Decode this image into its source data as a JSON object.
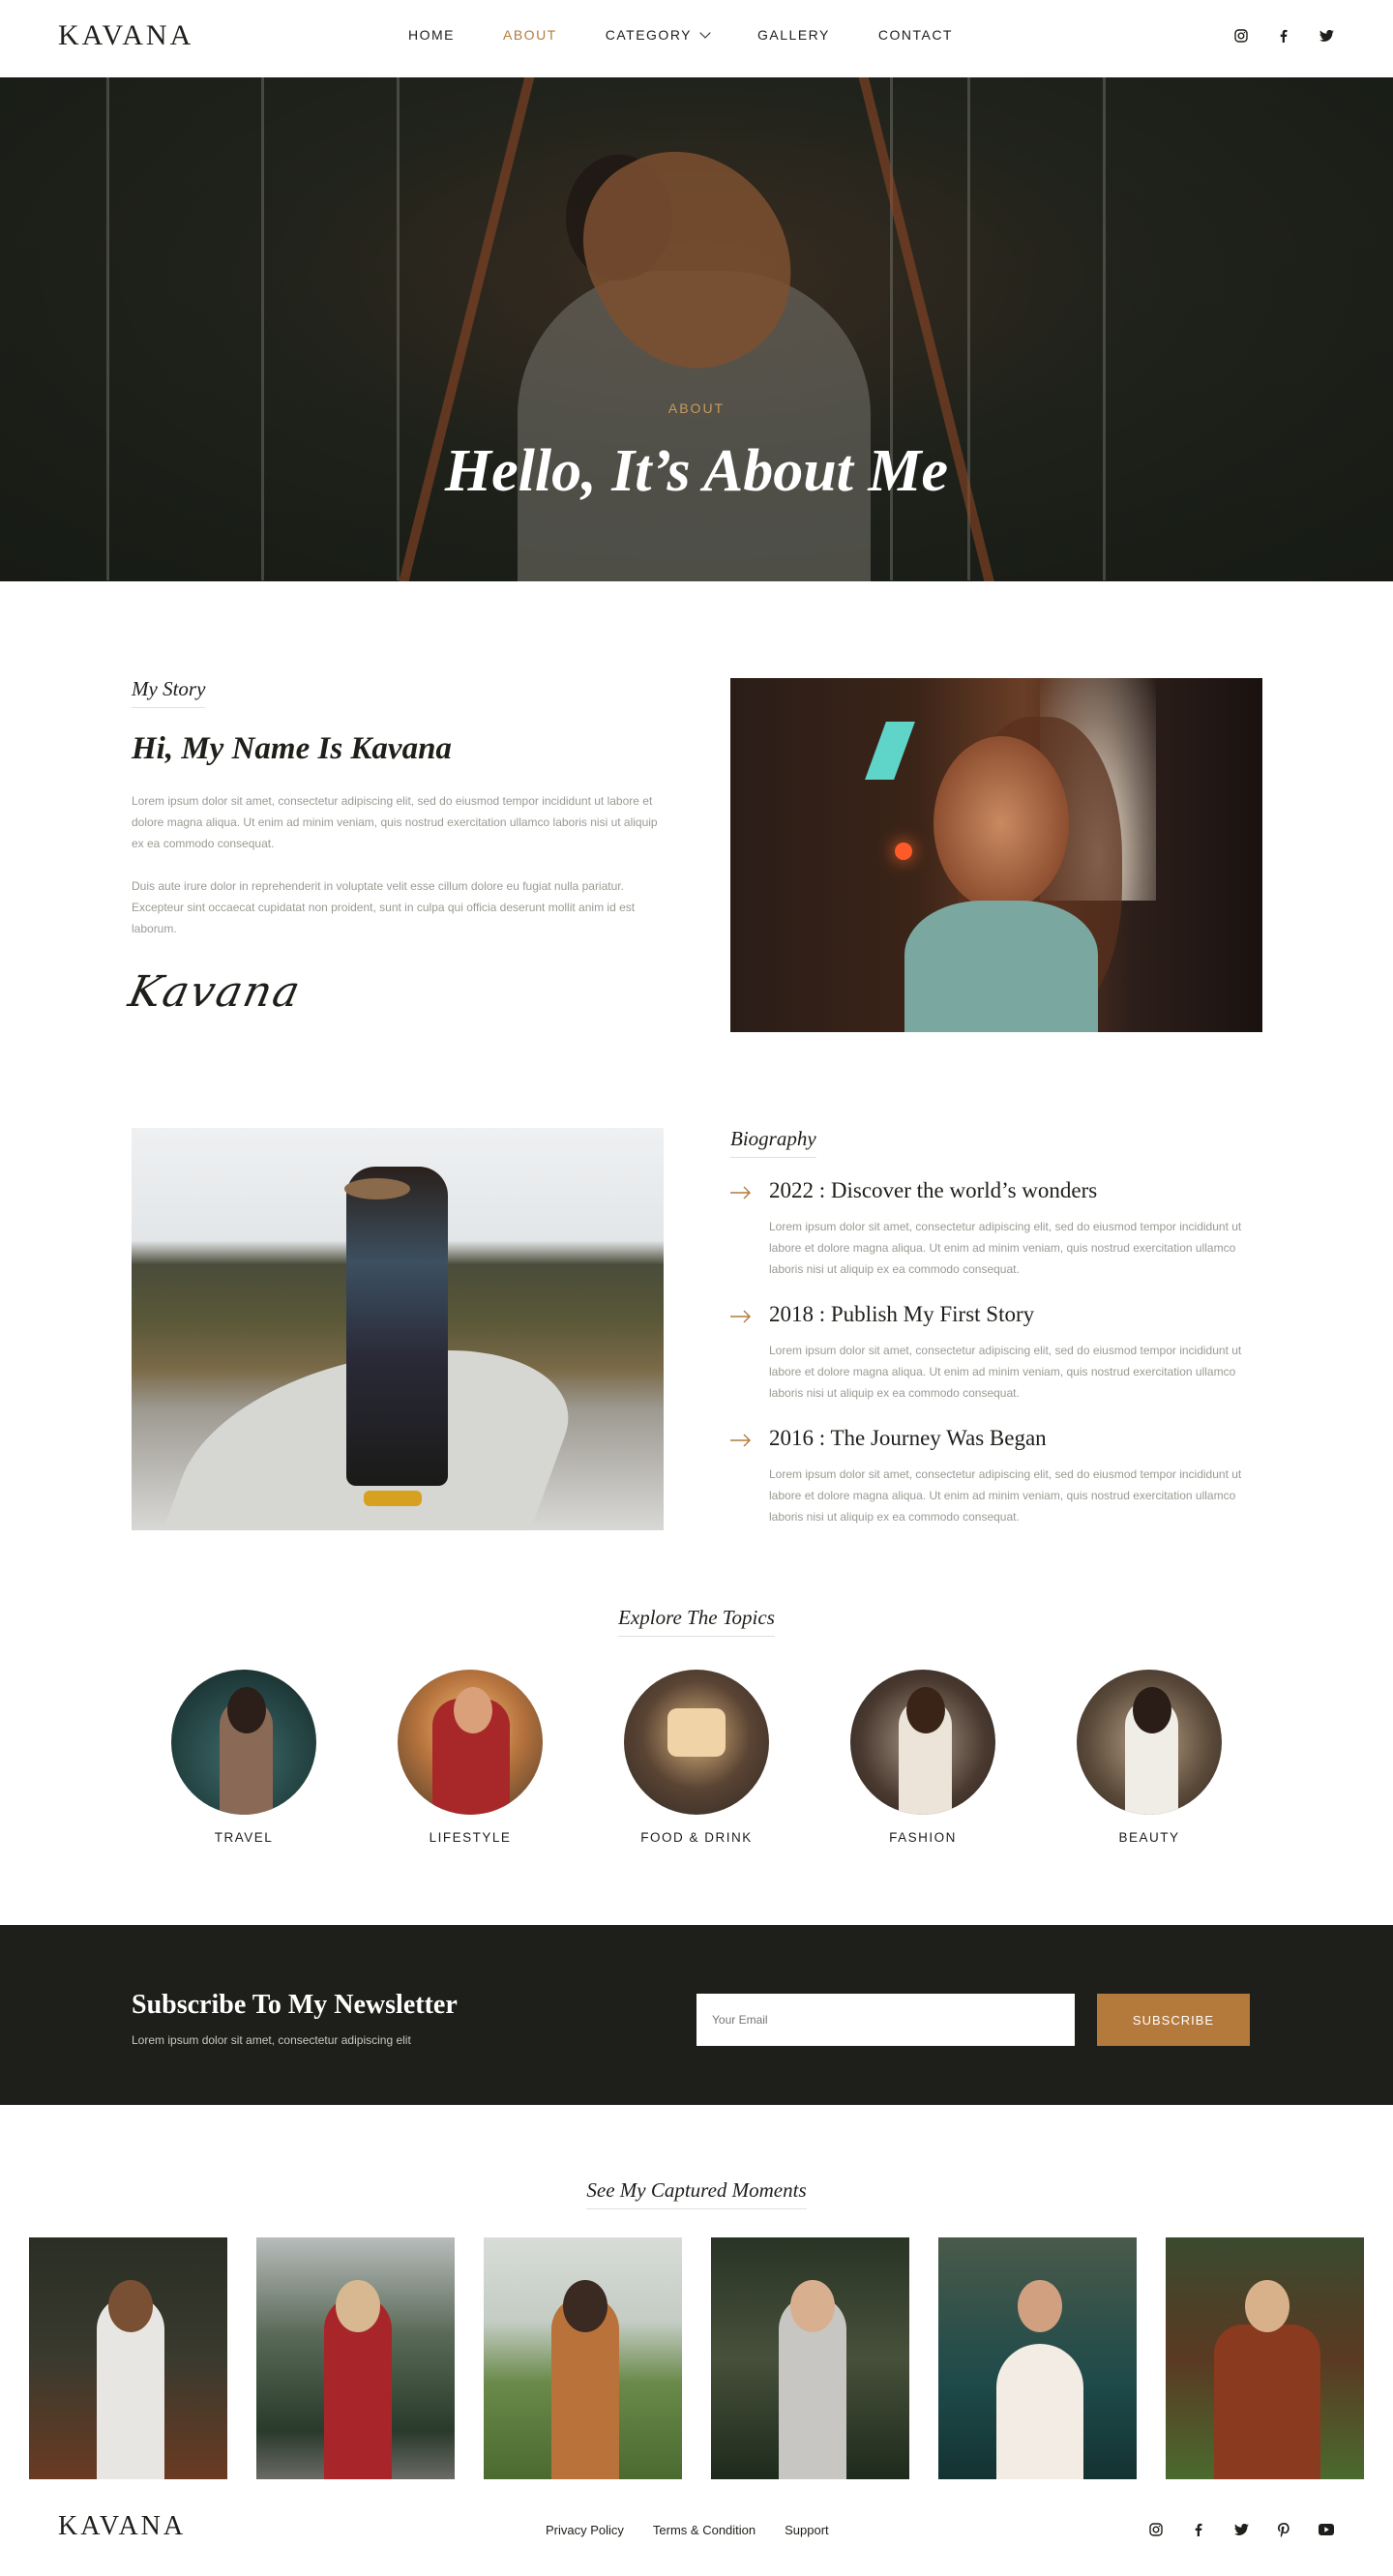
{
  "brand": {
    "logo": "KAVANA"
  },
  "nav": {
    "items": [
      {
        "label": "HOME",
        "active": false
      },
      {
        "label": "ABOUT",
        "active": true
      },
      {
        "label": "CATEGORY",
        "active": false,
        "has_dropdown": true
      },
      {
        "label": "GALLERY",
        "active": false
      },
      {
        "label": "CONTACT",
        "active": false
      }
    ]
  },
  "social_icons": [
    "instagram-icon",
    "facebook-icon",
    "twitter-icon"
  ],
  "hero": {
    "kicker": "ABOUT",
    "title": "Hello, It’s About Me"
  },
  "story": {
    "label": "My Story",
    "title": "Hi, My Name Is Kavana",
    "paragraph_1": "Lorem ipsum dolor sit amet, consectetur adipiscing elit, sed do eiusmod tempor incididunt ut labore et dolore magna aliqua. Ut enim ad minim veniam, quis nostrud exercitation ullamco laboris nisi ut aliquip ex ea commodo consequat.",
    "paragraph_2": "Duis aute irure dolor in reprehenderit in voluptate velit esse cillum dolore eu fugiat nulla pariatur. Excepteur sint occaecat cupidatat non proident, sunt in culpa qui officia deserunt mollit anim id est laborum.",
    "signature": "Kavana"
  },
  "biography": {
    "label": "Biography",
    "items": [
      {
        "title": "2022 : Discover the world’s wonders",
        "text": "Lorem ipsum dolor sit amet, consectetur adipiscing elit, sed do eiusmod tempor incididunt ut labore et dolore magna aliqua. Ut enim ad minim veniam, quis nostrud exercitation ullamco laboris nisi ut aliquip ex ea commodo consequat."
      },
      {
        "title": "2018 : Publish My First Story",
        "text": "Lorem ipsum dolor sit amet, consectetur adipiscing elit, sed do eiusmod tempor incididunt ut labore et dolore magna aliqua. Ut enim ad minim veniam, quis nostrud exercitation ullamco laboris nisi ut aliquip ex ea commodo consequat."
      },
      {
        "title": "2016 : The Journey Was Began",
        "text": "Lorem ipsum dolor sit amet, consectetur adipiscing elit, sed do eiusmod tempor incididunt ut labore et dolore magna aliqua. Ut enim ad minim veniam, quis nostrud exercitation ullamco laboris nisi ut aliquip ex ea commodo consequat."
      }
    ]
  },
  "topics": {
    "label": "Explore The Topics",
    "items": [
      {
        "name": "TRAVEL"
      },
      {
        "name": "LIFESTYLE"
      },
      {
        "name": "FOOD & DRINK"
      },
      {
        "name": "FASHION"
      },
      {
        "name": "BEAUTY"
      }
    ]
  },
  "newsletter": {
    "title": "Subscribe To My Newsletter",
    "subtitle": "Lorem ipsum dolor sit amet, consectetur adipiscing elit",
    "email_placeholder": "Your Email",
    "button_label": "SUBSCRIBE"
  },
  "moments": {
    "label": "See My Captured Moments"
  },
  "footer": {
    "logo": "KAVANA",
    "links": [
      "Privacy Policy",
      "Terms & Condition",
      "Support"
    ],
    "social_icons": [
      "instagram-icon",
      "facebook-icon",
      "twitter-icon",
      "pinterest-icon",
      "youtube-icon"
    ]
  },
  "colors": {
    "accent": "#b47a3c",
    "dark": "#1e1e1a",
    "muted_text": "#9a9a94"
  }
}
